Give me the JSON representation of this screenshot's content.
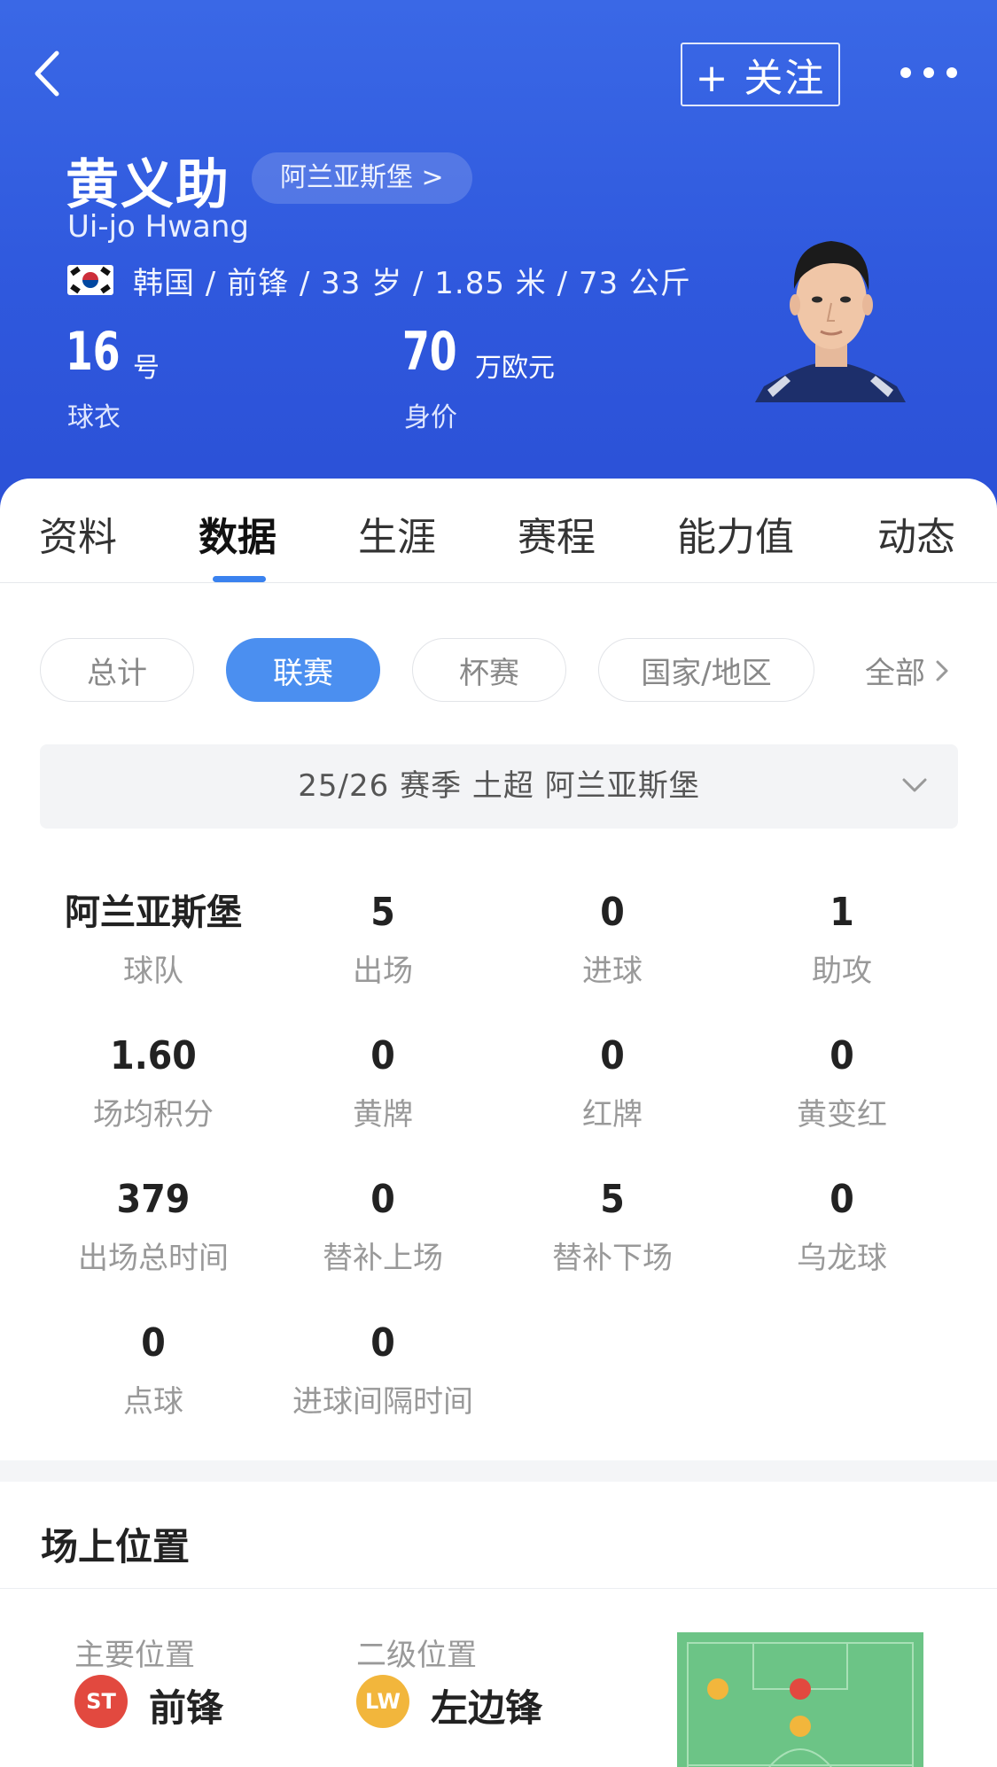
{
  "header": {
    "follow_label": "+ 关注",
    "player_name": "黄义助",
    "club_chip": "阿兰亚斯堡 >",
    "player_name_en": "Ui-jo Hwang",
    "info": "韩国 / 前锋 / 33 岁 / 1.85 米 / 73 公斤",
    "jersey_number": "16",
    "jersey_unit": "号",
    "jersey_label": "球衣",
    "value_number": "70",
    "value_unit": "万欧元",
    "value_label": "身价"
  },
  "tabs": [
    "资料",
    "数据",
    "生涯",
    "赛程",
    "能力值",
    "动态"
  ],
  "active_tab": "数据",
  "filters": [
    "总计",
    "联赛",
    "杯赛",
    "国家/地区"
  ],
  "active_filter": "联赛",
  "filter_all": "全部",
  "season": "25/26 赛季  土超  阿兰亚斯堡",
  "stats": [
    {
      "value": "阿兰亚斯堡",
      "label": "球队"
    },
    {
      "value": "5",
      "label": "出场"
    },
    {
      "value": "0",
      "label": "进球"
    },
    {
      "value": "1",
      "label": "助攻"
    },
    {
      "value": "1.60",
      "label": "场均积分"
    },
    {
      "value": "0",
      "label": "黄牌"
    },
    {
      "value": "0",
      "label": "红牌"
    },
    {
      "value": "0",
      "label": "黄变红"
    },
    {
      "value": "379",
      "label": "出场总时间"
    },
    {
      "value": "0",
      "label": "替补上场"
    },
    {
      "value": "5",
      "label": "替补下场"
    },
    {
      "value": "0",
      "label": "乌龙球"
    },
    {
      "value": "0",
      "label": "点球"
    },
    {
      "value": "0",
      "label": "进球间隔时间"
    }
  ],
  "position": {
    "title": "场上位置",
    "primary_label": "主要位置",
    "primary_badge": "ST",
    "primary_name": "前锋",
    "secondary_label": "二级位置",
    "secondary_badge": "LW",
    "secondary_name": "左边锋"
  },
  "colors": {
    "header_blue": "#2f58dd",
    "accent_blue": "#4b8ff0",
    "primary_badge": "#e2493f",
    "secondary_badge": "#f2b63c",
    "pitch_green": "#6cc486"
  },
  "icons": [
    "back-arrow-icon",
    "more-dots-icon",
    "korea-flag-icon",
    "chevron-right-icon",
    "chevron-down-icon"
  ]
}
